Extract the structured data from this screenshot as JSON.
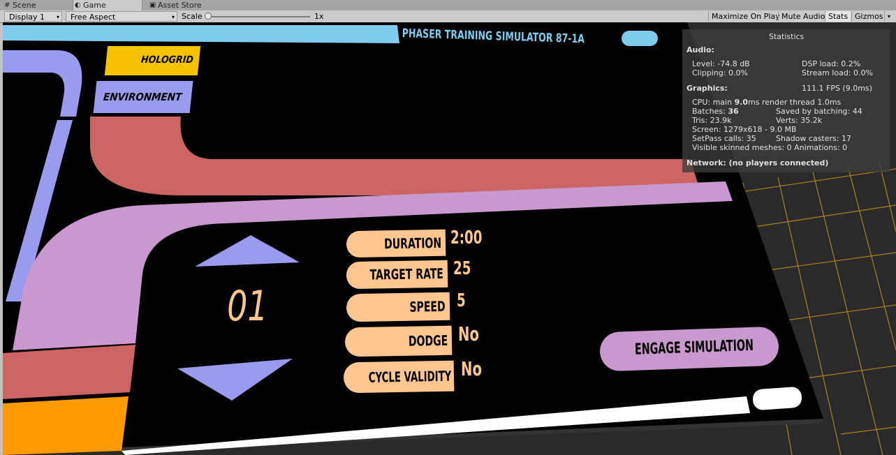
{
  "tabs": [
    {
      "label": "Scene",
      "icon": "grid-icon"
    },
    {
      "label": "Game",
      "icon": "pacman-icon"
    },
    {
      "label": "Asset Store",
      "icon": "bag-icon"
    }
  ],
  "toolbar": {
    "display": "Display 1",
    "aspect": "Free Aspect",
    "scale_label": "Scale",
    "scale_value": "1x",
    "maximize": "Maximize On Play",
    "mute": "Mute Audio",
    "stats": "Stats",
    "gizmos": "Gizmos"
  },
  "panel": {
    "title": "PHASER TRAINING SIMULATOR 87-1A",
    "tabs": [
      "HOLOGRID",
      "ENVIRONMENT"
    ],
    "counter": "01",
    "settings": [
      {
        "label": "DURATION",
        "value": "2:00"
      },
      {
        "label": "TARGET RATE",
        "value": "25"
      },
      {
        "label": "SPEED",
        "value": "5"
      },
      {
        "label": "DODGE",
        "value": "No"
      },
      {
        "label": "CYCLE VALIDITY",
        "value": "No"
      }
    ],
    "engage": "ENGAGE SIMULATION"
  },
  "stats": {
    "title": "Statistics",
    "audio_h": "Audio:",
    "level": "Level: -74.8 dB",
    "clipping": "Clipping: 0.0%",
    "dsp": "DSP load: 0.2%",
    "stream": "Stream load: 0.0%",
    "graphics_h": "Graphics:",
    "fps": "111.1 FPS (9.0ms)",
    "cpu_a": "CPU: main ",
    "cpu_b": "9.0",
    "cpu_c": "ms  render thread 1.0ms",
    "batches_a": "Batches: ",
    "batches_b": "36",
    "saved": "Saved by batching: 44",
    "tris": "Tris: 23.9k",
    "verts": "Verts: 35.2k",
    "screen": "Screen: 1279x618 - 9.0 MB",
    "setpass": "SetPass calls: 35",
    "shadow": "Shadow casters: 17",
    "skinned": "Visible skinned meshes: 0  Animations: 0",
    "network": "Network: (no players connected)"
  },
  "colors": {
    "blue": "#7ecbee",
    "gold": "#f5c200",
    "lavender": "#9a9aee",
    "salmon": "#cd6464",
    "pink": "#c898ce",
    "peach": "#ffc690",
    "orange": "#ff9a00",
    "grid": "#b78e1c"
  }
}
